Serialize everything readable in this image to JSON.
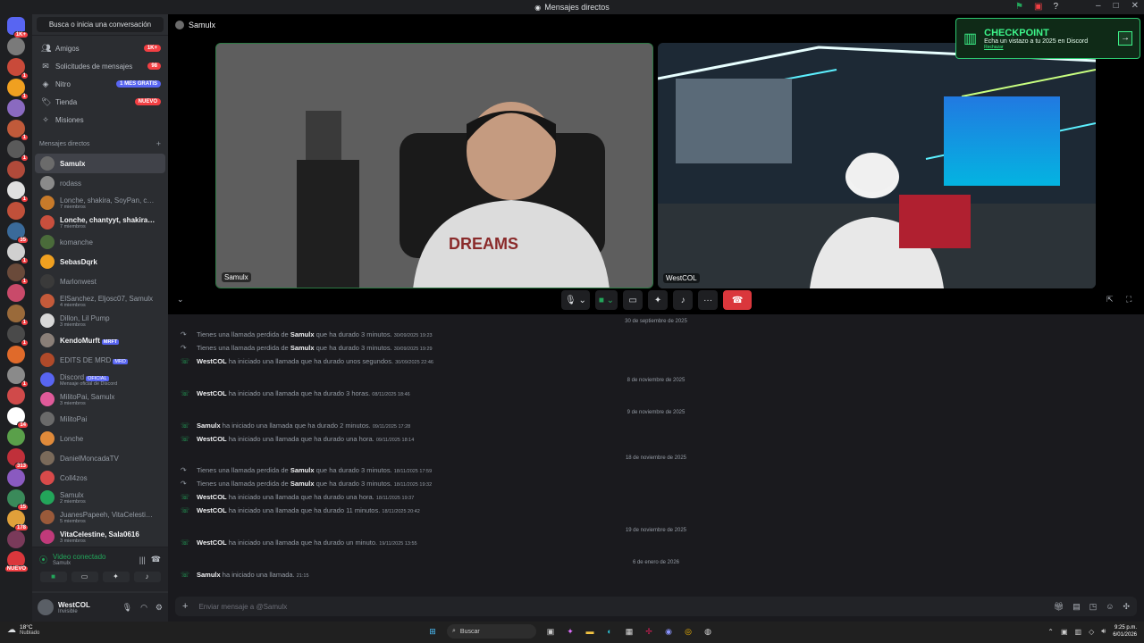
{
  "window": {
    "title": "Mensajes directos"
  },
  "sidebar": {
    "search_label": "Busca o inicia una conversación",
    "nav": [
      {
        "label": "Amigos",
        "icon": "friends-icon",
        "badge": "1K+",
        "badge_style": "red"
      },
      {
        "label": "Solicitudes de mensajes",
        "icon": "envelope-icon",
        "badge": "98",
        "badge_style": "red"
      },
      {
        "label": "Nitro",
        "icon": "nitro-icon",
        "badge": "1 MES GRATIS",
        "badge_style": "purple"
      },
      {
        "label": "Tienda",
        "icon": "shop-icon",
        "badge": "NUEVO",
        "badge_style": "red"
      },
      {
        "label": "Misiones",
        "icon": "compass-icon",
        "badge": "",
        "badge_style": ""
      }
    ],
    "dm_header": "Mensajes directos",
    "dms": [
      {
        "name": "Samulx",
        "sub": "",
        "bright": true,
        "active": true,
        "color": "#6b6b6b"
      },
      {
        "name": "rodass",
        "sub": "",
        "bright": false,
        "active": false,
        "color": "#8a8a8a"
      },
      {
        "name": "Lonche, shakira, SoyPan, cha...",
        "sub": "7 miembros",
        "bright": false,
        "active": false,
        "color": "#c77a2a"
      },
      {
        "name": "Lonche, chantyyt, shakira, Sa...",
        "sub": "7 miembros",
        "bright": true,
        "active": false,
        "color": "#c94f3d"
      },
      {
        "name": "komanche",
        "sub": "",
        "bright": false,
        "active": false,
        "color": "#4a6b3a"
      },
      {
        "name": "SebasDqrk",
        "sub": "",
        "bright": true,
        "active": false,
        "color": "#f0a020"
      },
      {
        "name": "Marlonwest",
        "sub": "",
        "bright": false,
        "active": false,
        "color": "#3a3a3a"
      },
      {
        "name": "ElSanchez, Eljosc07, Samulx",
        "sub": "4 miembros",
        "bright": false,
        "active": false,
        "color": "#c45a3a"
      },
      {
        "name": "Dillon, Lil Pump",
        "sub": "3 miembros",
        "bright": false,
        "active": false,
        "color": "#d8d8d8"
      },
      {
        "name": "KendoMurft",
        "sub": "",
        "bright": true,
        "active": false,
        "color": "#8a7f78",
        "tag": "MRFT"
      },
      {
        "name": "EDITS DE MRD",
        "sub": "",
        "bright": false,
        "active": false,
        "color": "#b04a2a",
        "tag": "MRD"
      },
      {
        "name": "Discord",
        "sub": "Mensaje oficial de Discord",
        "bright": false,
        "active": false,
        "color": "#5865f2",
        "tag": "OFICIAL"
      },
      {
        "name": "MilitoPai, Samulx",
        "sub": "3 miembros",
        "bright": false,
        "active": false,
        "color": "#e05a9a"
      },
      {
        "name": "MilitoPai",
        "sub": "",
        "bright": false,
        "active": false,
        "color": "#6a6a6a"
      },
      {
        "name": "Lonche",
        "sub": "",
        "bright": false,
        "active": false,
        "color": "#e08a3a"
      },
      {
        "name": "DanielMoncadaTV",
        "sub": "",
        "bright": false,
        "active": false,
        "color": "#7a6a5a"
      },
      {
        "name": "Coll4zos",
        "sub": "",
        "bright": false,
        "active": false,
        "color": "#d84a4a"
      },
      {
        "name": "Samulx",
        "sub": "2 miembros",
        "bright": false,
        "active": false,
        "color": "#23a55a"
      },
      {
        "name": "JuanesPapeeh, VitaCelestine,...",
        "sub": "5 miembros",
        "bright": false,
        "active": false,
        "color": "#9a5a3a"
      },
      {
        "name": "VitaCelestine, Sala0616",
        "sub": "3 miembros",
        "bright": true,
        "active": false,
        "color": "#c03a7a"
      }
    ]
  },
  "voice": {
    "status": "Video conectado",
    "channel": "Samulx"
  },
  "user": {
    "name": "WestCOL",
    "status": "Invisible"
  },
  "call": {
    "header": "Samulx",
    "participants": [
      {
        "label": "Samulx"
      },
      {
        "label": "WestCOL"
      }
    ]
  },
  "promo": {
    "title": "CHECKPOINT",
    "text": "Echa un vistazo a tu 2025 en Discord",
    "dismiss": "Rechazar"
  },
  "chat": {
    "dates": [
      {
        "label": "30 de septiembre de 2025"
      },
      {
        "label": "8 de noviembre de 2025"
      },
      {
        "label": "9 de noviembre de 2025"
      },
      {
        "label": "18 de noviembre de 2025"
      },
      {
        "label": "19 de noviembre de 2025"
      },
      {
        "label": "6 de enero de 2026"
      }
    ],
    "rows": [
      {
        "kind": "miss",
        "pre": "Tienes una llamada perdida de",
        "who": "Samulx",
        "post": "que ha durado 3 minutos.",
        "ts": "30/09/2025 19:23"
      },
      {
        "kind": "miss",
        "pre": "Tienes una llamada perdida de",
        "who": "Samulx",
        "post": "que ha durado 3 minutos.",
        "ts": "30/09/2025 19:29"
      },
      {
        "kind": "ok",
        "pre": "",
        "who": "WestCOL",
        "post": "ha iniciado una llamada que ha durado unos segundos.",
        "ts": "30/09/2025 22:46"
      },
      {
        "kind": "ok",
        "pre": "",
        "who": "WestCOL",
        "post": "ha iniciado una llamada que ha durado 3 horas.",
        "ts": "08/11/2025 18:46"
      },
      {
        "kind": "ok",
        "pre": "",
        "who": "Samulx",
        "post": "ha iniciado una llamada que ha durado 2 minutos.",
        "ts": "09/11/2025 17:28"
      },
      {
        "kind": "ok",
        "pre": "",
        "who": "WestCOL",
        "post": "ha iniciado una llamada que ha durado una hora.",
        "ts": "09/11/2025 18:14"
      },
      {
        "kind": "miss",
        "pre": "Tienes una llamada perdida de",
        "who": "Samulx",
        "post": "que ha durado 3 minutos.",
        "ts": "18/11/2025 17:59"
      },
      {
        "kind": "miss",
        "pre": "Tienes una llamada perdida de",
        "who": "Samulx",
        "post": "que ha durado 3 minutos.",
        "ts": "18/11/2025 19:32"
      },
      {
        "kind": "ok",
        "pre": "",
        "who": "WestCOL",
        "post": "ha iniciado una llamada que ha durado una hora.",
        "ts": "18/11/2025 19:37"
      },
      {
        "kind": "ok",
        "pre": "",
        "who": "WestCOL",
        "post": "ha iniciado una llamada que ha durado 11 minutos.",
        "ts": "18/11/2025 20:42"
      },
      {
        "kind": "ok",
        "pre": "",
        "who": "WestCOL",
        "post": "ha iniciado una llamada que ha durado un minuto.",
        "ts": "19/11/2025 13:55"
      },
      {
        "kind": "ok",
        "pre": "",
        "who": "Samulx",
        "post": "ha iniciado una llamada.",
        "ts": "21:15"
      }
    ]
  },
  "composer": {
    "placeholder": "Enviar mensaje a @Samulx"
  },
  "taskbar": {
    "temp": "18°C",
    "condition": "Nublado",
    "search": "Buscar",
    "time": "9:25 p.m.",
    "date": "6/01/2026"
  },
  "servers": [
    {
      "color": "#5865f2",
      "badge": "1K+"
    },
    {
      "color": "#7a7a7a",
      "badge": ""
    },
    {
      "color": "#c94a3a",
      "badge": "1"
    },
    {
      "color": "#f0a020",
      "badge": "1"
    },
    {
      "color": "#8a6ac0",
      "badge": ""
    },
    {
      "color": "#c05a3a",
      "badge": "1"
    },
    {
      "color": "#5a5a5a",
      "badge": "1"
    },
    {
      "color": "#b04a3a",
      "badge": ""
    },
    {
      "color": "#e0e0e0",
      "badge": "1"
    },
    {
      "color": "#c0503a",
      "badge": ""
    },
    {
      "color": "#3a6a9a",
      "badge": "35"
    },
    {
      "color": "#d0d0d0",
      "badge": "1"
    },
    {
      "color": "#6a4a3a",
      "badge": "1"
    },
    {
      "color": "#c94a6a",
      "badge": ""
    },
    {
      "color": "#9a6a3a",
      "badge": "1"
    },
    {
      "color": "#4a4a4a",
      "badge": "1"
    },
    {
      "color": "#e06a2a",
      "badge": ""
    },
    {
      "color": "#8a8a8a",
      "badge": "1"
    },
    {
      "color": "#d04a4a",
      "badge": ""
    },
    {
      "color": "#ffffff",
      "badge": "14"
    },
    {
      "color": "#5aa04a",
      "badge": ""
    },
    {
      "color": "#c0303a",
      "badge": "313"
    },
    {
      "color": "#8a5ac0",
      "badge": ""
    },
    {
      "color": "#3a8a5a",
      "badge": "15"
    },
    {
      "color": "#e0a03a",
      "badge": "178"
    },
    {
      "color": "#7a3a5a",
      "badge": ""
    },
    {
      "color": "#da373c",
      "badge": "NUEVO"
    }
  ],
  "colors": {
    "accent": "#5865f2",
    "green": "#23a55a",
    "red": "#da373c",
    "promo": "#3df58a"
  }
}
